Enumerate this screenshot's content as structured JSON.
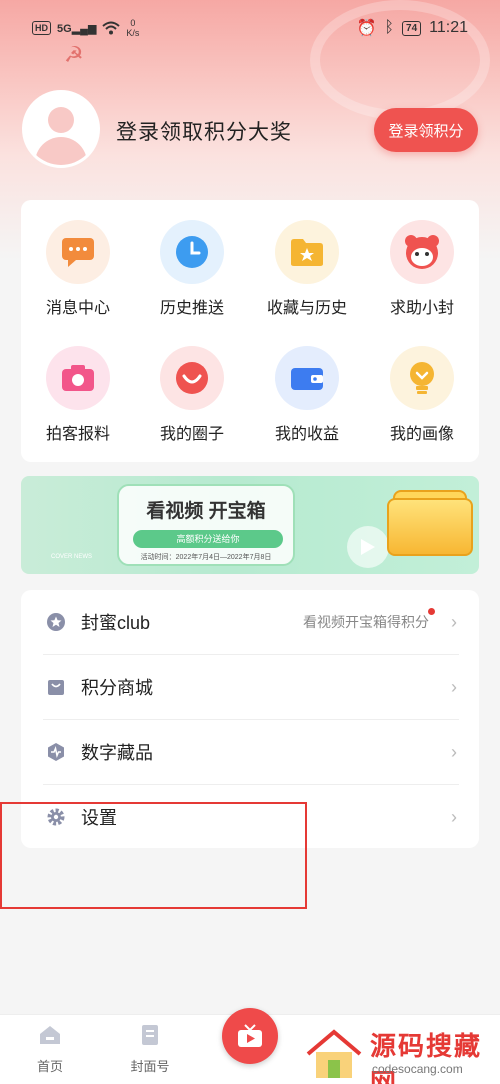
{
  "status_bar": {
    "hd": "HD",
    "net": "5G",
    "speed_value": "0",
    "speed_unit": "K/s",
    "battery": "74",
    "time": "11:21"
  },
  "profile": {
    "login_text": "登录领取积分大奖",
    "login_button": "登录领积分"
  },
  "grid": [
    {
      "label": "消息中心",
      "icon": "message-icon",
      "color": "#f28b3c",
      "bg": "#fdeee3"
    },
    {
      "label": "历史推送",
      "icon": "clock-icon",
      "color": "#3d9cf0",
      "bg": "#e4f1fd"
    },
    {
      "label": "收藏与历史",
      "icon": "folder-star-icon",
      "color": "#f5b532",
      "bg": "#fdf3dd"
    },
    {
      "label": "求助小封",
      "icon": "mascot-icon",
      "color": "#ef5350",
      "bg": "#fde4e4"
    },
    {
      "label": "拍客报料",
      "icon": "camera-icon",
      "color": "#f2568a",
      "bg": "#fde3ec"
    },
    {
      "label": "我的圈子",
      "icon": "smile-circle-icon",
      "color": "#ef5350",
      "bg": "#fde4e4"
    },
    {
      "label": "我的收益",
      "icon": "wallet-icon",
      "color": "#3d7cf0",
      "bg": "#e4edfd"
    },
    {
      "label": "我的画像",
      "icon": "bulb-icon",
      "color": "#f5b532",
      "bg": "#fdf3dd"
    }
  ],
  "banner": {
    "title": "看视频 开宝箱",
    "subtitle": "高额积分送给你",
    "date": "活动时间：2022年7月4日—2022年7月8日",
    "cover": "COVER NEWS"
  },
  "list": [
    {
      "label": "封蜜club",
      "icon": "star-badge-icon",
      "hint": "看视频开宝箱得积分",
      "dot": true
    },
    {
      "label": "积分商城",
      "icon": "bag-icon",
      "hint": "",
      "dot": false
    },
    {
      "label": "数字藏品",
      "icon": "hexagon-icon",
      "hint": "",
      "dot": false
    },
    {
      "label": "设置",
      "icon": "gear-icon",
      "hint": "",
      "dot": false
    }
  ],
  "tabs": [
    {
      "label": "首页",
      "icon": "home-icon"
    },
    {
      "label": "封面号",
      "icon": "document-icon"
    }
  ],
  "watermark": {
    "title": "源码搜藏网",
    "url": "codesocang.com"
  },
  "colors": {
    "accent": "#ef5350",
    "annotation": "#e53935"
  }
}
